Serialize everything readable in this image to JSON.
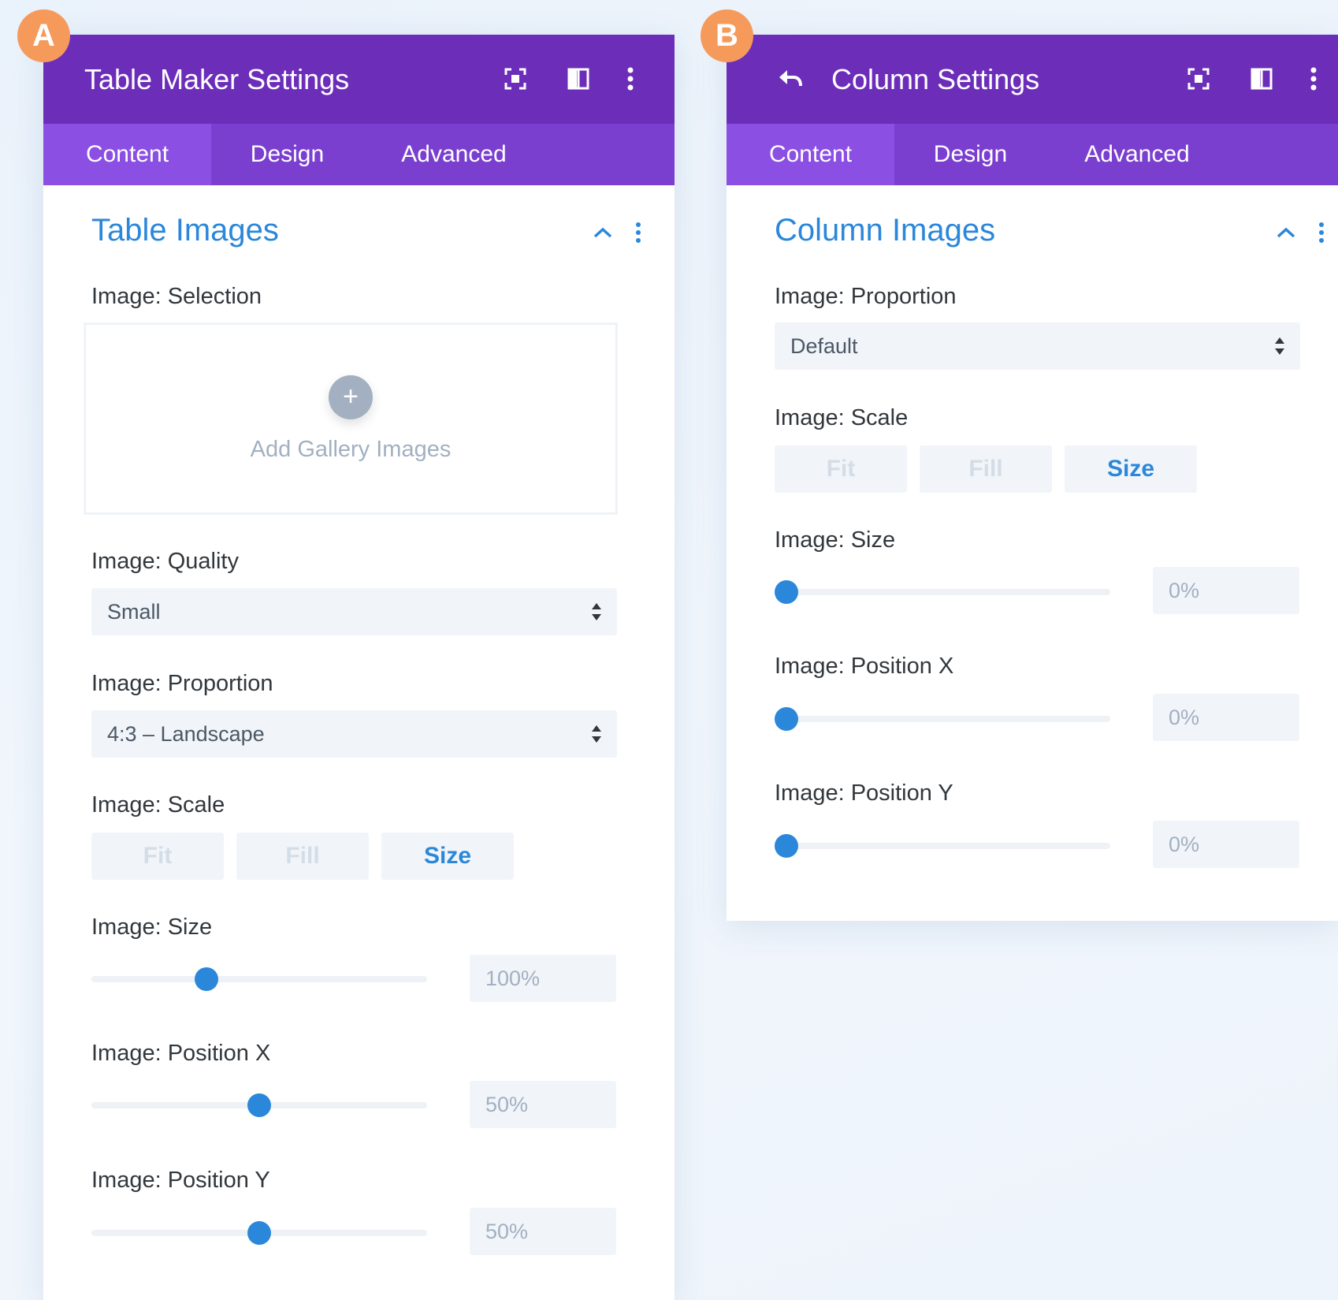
{
  "badges": {
    "a": "A",
    "b": "B"
  },
  "panel_a": {
    "title": "Table Maker Settings",
    "icons": [
      "focus-icon",
      "split-view-icon",
      "more-vertical-icon"
    ],
    "tabs": [
      "Content",
      "Design",
      "Advanced"
    ],
    "active_tab": "Content",
    "section_title": "Table Images",
    "image_selection_label": "Image: Selection",
    "upload": {
      "plus": "+",
      "text": "Add Gallery Images"
    },
    "quality": {
      "label": "Image: Quality",
      "value": "Small"
    },
    "proportion": {
      "label": "Image: Proportion",
      "value": "4:3 – Landscape"
    },
    "scale": {
      "label": "Image: Scale",
      "options": [
        "Fit",
        "Fill",
        "Size"
      ],
      "selected": "Size"
    },
    "sliders": [
      {
        "label": "Image: Size",
        "value": "100%",
        "fraction": 0.343
      },
      {
        "label": "Image: Position X",
        "value": "50%",
        "fraction": 0.5
      },
      {
        "label": "Image: Position Y",
        "value": "50%",
        "fraction": 0.5
      }
    ]
  },
  "panel_b": {
    "title": "Column Settings",
    "icons": [
      "back-arrow-icon",
      "focus-icon",
      "split-view-icon",
      "more-vertical-icon"
    ],
    "tabs": [
      "Content",
      "Design",
      "Advanced"
    ],
    "active_tab": "Content",
    "section_title": "Column Images",
    "proportion": {
      "label": "Image: Proportion",
      "value": "Default"
    },
    "scale": {
      "label": "Image: Scale",
      "options": [
        "Fit",
        "Fill",
        "Size"
      ],
      "selected": "Size"
    },
    "sliders": [
      {
        "label": "Image: Size",
        "value": "0%",
        "fraction": 0.0
      },
      {
        "label": "Image: Position X",
        "value": "0%",
        "fraction": 0.0
      },
      {
        "label": "Image: Position Y",
        "value": "0%",
        "fraction": 0.0
      }
    ]
  },
  "colors": {
    "header": "#6c2eb9",
    "tabs": "#7b3fd0",
    "active_tab": "#8c4fe4",
    "accent_blue": "#2b87da",
    "badge": "#f59a5b"
  }
}
